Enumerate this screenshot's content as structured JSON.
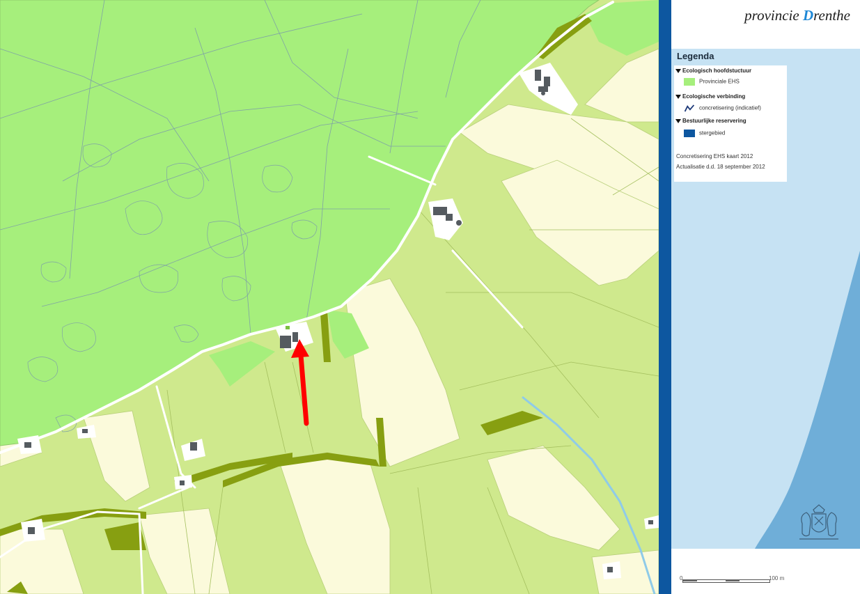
{
  "logo": {
    "prefix": "provincie",
    "initial": "D",
    "name": "renthe"
  },
  "legend": {
    "title": "Legenda",
    "groups": [
      {
        "heading": "Ecologisch hoofdstuctuur",
        "item": "Provinciale EHS",
        "color": "#a6ef7c"
      },
      {
        "heading": "Ecologische verbinding",
        "item": "concretisering (indicatief)",
        "color": "#1f3b7a"
      },
      {
        "heading": "Bestuurlijke reservering",
        "item": "stergebied",
        "color": "#0d57a0"
      }
    ],
    "notes": [
      "Concretisering EHS kaart 2012",
      "Actualisatie d.d. 18 september 2012"
    ]
  },
  "scale": {
    "start": "0",
    "end": "100 m"
  },
  "icons": {
    "pointer": "red-arrow-icon",
    "crest": "coat-of-arms-icon"
  },
  "colors": {
    "ehs": "#a6ef7c",
    "field": "#cfe98d",
    "field_light": "#fbfadb",
    "field_dark": "#879f11",
    "sidebar_blue": "#0d57a0",
    "sea_light": "#c6e2f3",
    "sea_dark": "#6faed8",
    "arrow": "#ff0000"
  }
}
